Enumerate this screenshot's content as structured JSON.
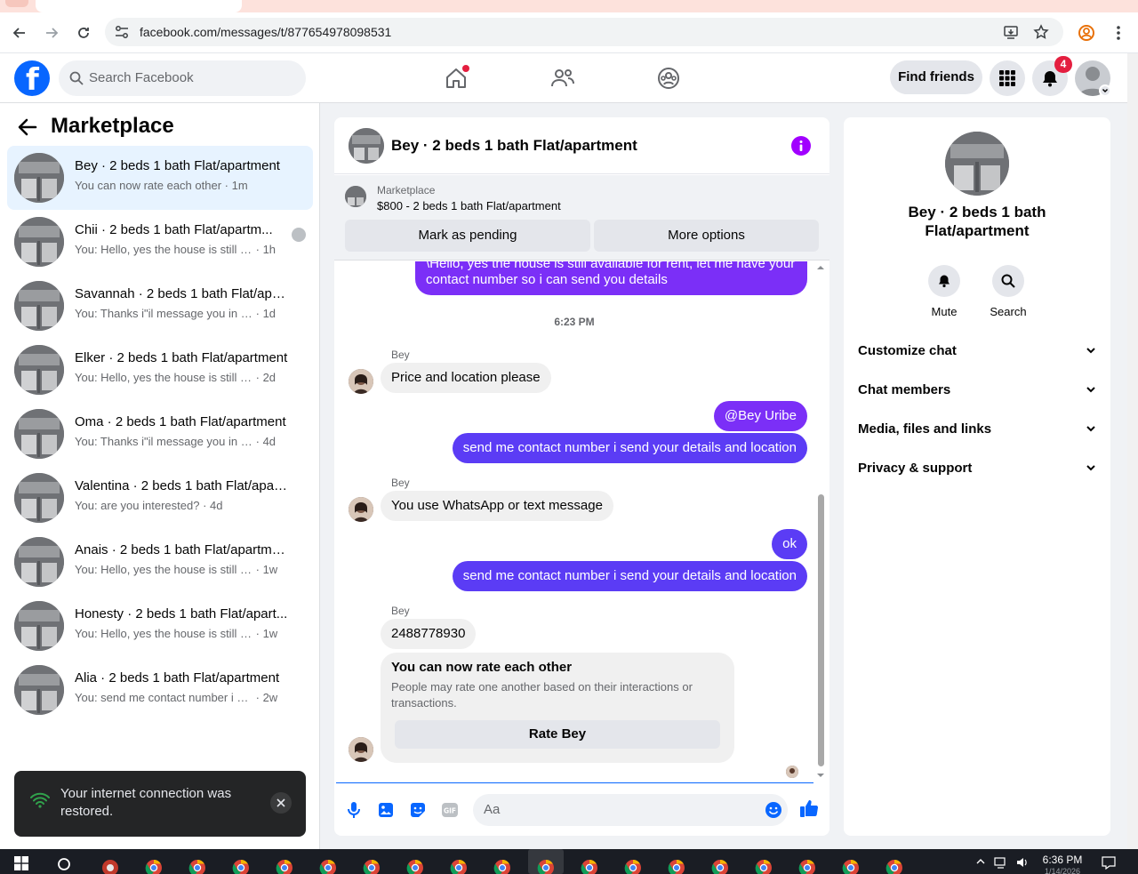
{
  "browser": {
    "url": "facebook.com/messages/t/877654978098531"
  },
  "header": {
    "search_placeholder": "Search Facebook",
    "find_friends_label": "Find friends",
    "notification_count": "4"
  },
  "sidebar": {
    "title": "Marketplace",
    "conversations": [
      {
        "name": "Bey · 2 beds 1 bath Flat/apartment",
        "preview": "You can now rate each other",
        "time": "1m",
        "active": true
      },
      {
        "name": "Chii · 2 beds 1 bath Flat/apartm...",
        "preview": "You: Hello, yes the house is still ava...",
        "time": "1h"
      },
      {
        "name": "Savannah · 2 beds 1 bath Flat/apar...",
        "preview": "You: Thanks i\"il message you in a mo...",
        "time": "1d"
      },
      {
        "name": "Elker · 2 beds 1 bath Flat/apartment",
        "preview": "You: Hello, yes the house is still availa...",
        "time": "2d"
      },
      {
        "name": "Oma · 2 beds 1 bath Flat/apartment",
        "preview": "You: Thanks i\"il message you in a mo...",
        "time": "4d"
      },
      {
        "name": "Valentina · 2 beds 1 bath Flat/apar...",
        "preview": "You: are you interested?",
        "time": "4d"
      },
      {
        "name": "Anais · 2 beds 1 bath Flat/apartment",
        "preview": "You: Hello, yes the house is still availa...",
        "time": "1w"
      },
      {
        "name": "Honesty · 2 beds 1 bath Flat/apart...",
        "preview": "You: Hello, yes the house is still availa...",
        "time": "1w"
      },
      {
        "name": "Alia · 2 beds 1 bath Flat/apartment",
        "preview": "You: send me contact number i send ...",
        "time": "2w"
      }
    ]
  },
  "toast": {
    "message": "Your internet connection was restored."
  },
  "chat": {
    "title": "Bey · 2 beds 1 bath Flat/apartment",
    "marketplace_label": "Marketplace",
    "listing": "$800 - 2 beds 1 bath Flat/apartment",
    "mark_pending_label": "Mark as pending",
    "more_options_label": "More options",
    "messages": {
      "m1": "\\Hello, yes the house is still available for rent, let me have your contact number so i can send you details",
      "timestamp": "6:23 PM",
      "sender1": "Bey",
      "m2": "Price and location please",
      "m3": "@Bey Uribe",
      "m4": "send me contact number i send your details and location",
      "sender2": "Bey",
      "m5": "You use WhatsApp or text message",
      "m6": "ok",
      "m7": "send me contact number i send your details and location",
      "sender3": "Bey",
      "m8": "2488778930"
    },
    "rate_card": {
      "title": "You can now rate each other",
      "description": "People may rate one another based on their interactions or transactions.",
      "button": "Rate Bey"
    },
    "composer_placeholder": "Aa"
  },
  "info_panel": {
    "name": "Bey · 2 beds 1 bath Flat/apartment",
    "mute_label": "Mute",
    "search_label": "Search",
    "sections": [
      "Customize chat",
      "Chat members",
      "Media, files and links",
      "Privacy & support"
    ]
  },
  "taskbar": {
    "time": "6:36 PM",
    "date": "1/14/2026"
  },
  "colors": {
    "brand": "#0866ff",
    "outgoing_bubble": "#7b2ff7",
    "outgoing_bubble_alt": "#5b3cf5",
    "info_icon": "#a100ff",
    "badge": "#e41e3f"
  }
}
